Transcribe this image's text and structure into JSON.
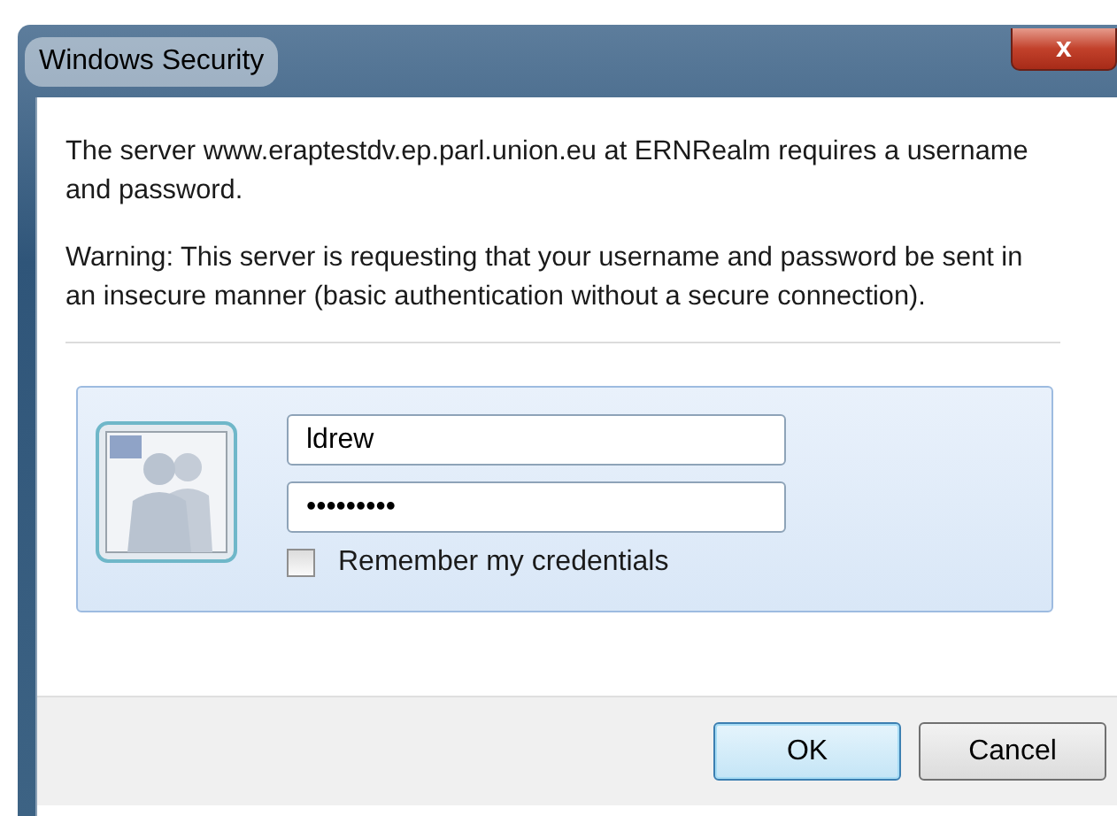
{
  "window": {
    "title": "Windows Security",
    "close": "x"
  },
  "message": "The server www.eraptestdv.ep.parl.union.eu at ERNRealm requires a username and password.",
  "warning": "Warning: This server is requesting that your username and password be sent in an insecure manner (basic authentication without a secure connection).",
  "credentials": {
    "username": {
      "value": "ldrew"
    },
    "password": {
      "value": "•••••••••"
    },
    "remember": {
      "label": "Remember my credentials",
      "checked": false
    }
  },
  "buttons": [
    {
      "label": "OK",
      "default": true
    },
    {
      "label": "Cancel",
      "default": false
    }
  ]
}
